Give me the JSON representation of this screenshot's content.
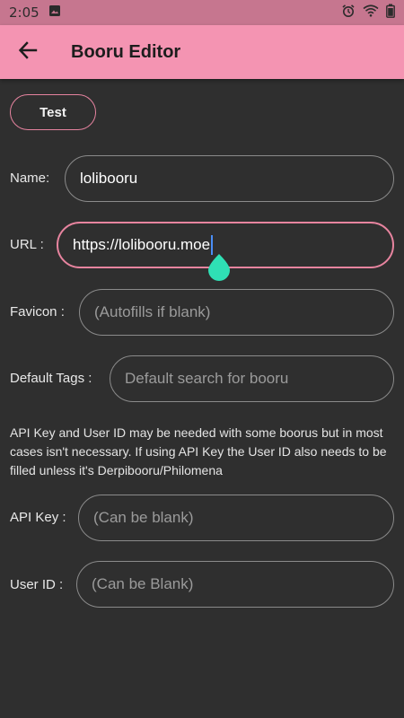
{
  "status_bar": {
    "time": "2:05",
    "icons": [
      "image-icon",
      "alarm-icon",
      "wifi-icon",
      "battery-icon"
    ]
  },
  "app_bar": {
    "title": "Booru Editor",
    "back_icon": "arrow-back-icon"
  },
  "test_button": {
    "label": "Test"
  },
  "form": {
    "name": {
      "label": "Name:",
      "value": "lolibooru"
    },
    "url": {
      "label": "URL :",
      "value": "https://lolibooru.moe"
    },
    "favicon": {
      "label": "Favicon :",
      "placeholder": "(Autofills if blank)"
    },
    "default_tags": {
      "label": "Default Tags :",
      "placeholder": "Default search for booru"
    },
    "info": "API Key and User ID may be needed with some boorus but in most cases isn't necessary. If using API Key the User ID also needs to be filled unless it's Derpibooru/Philomena",
    "api_key": {
      "label": "API Key :",
      "placeholder": "(Can be blank)"
    },
    "user_id": {
      "label": "User ID :",
      "placeholder": "(Can be Blank)"
    }
  },
  "colors": {
    "accent": "#f494b2",
    "status_bar": "#c6768f",
    "background": "#2f2f2f",
    "cursor_handle": "#2fe0b5",
    "field_border": "#8b8b8b"
  }
}
